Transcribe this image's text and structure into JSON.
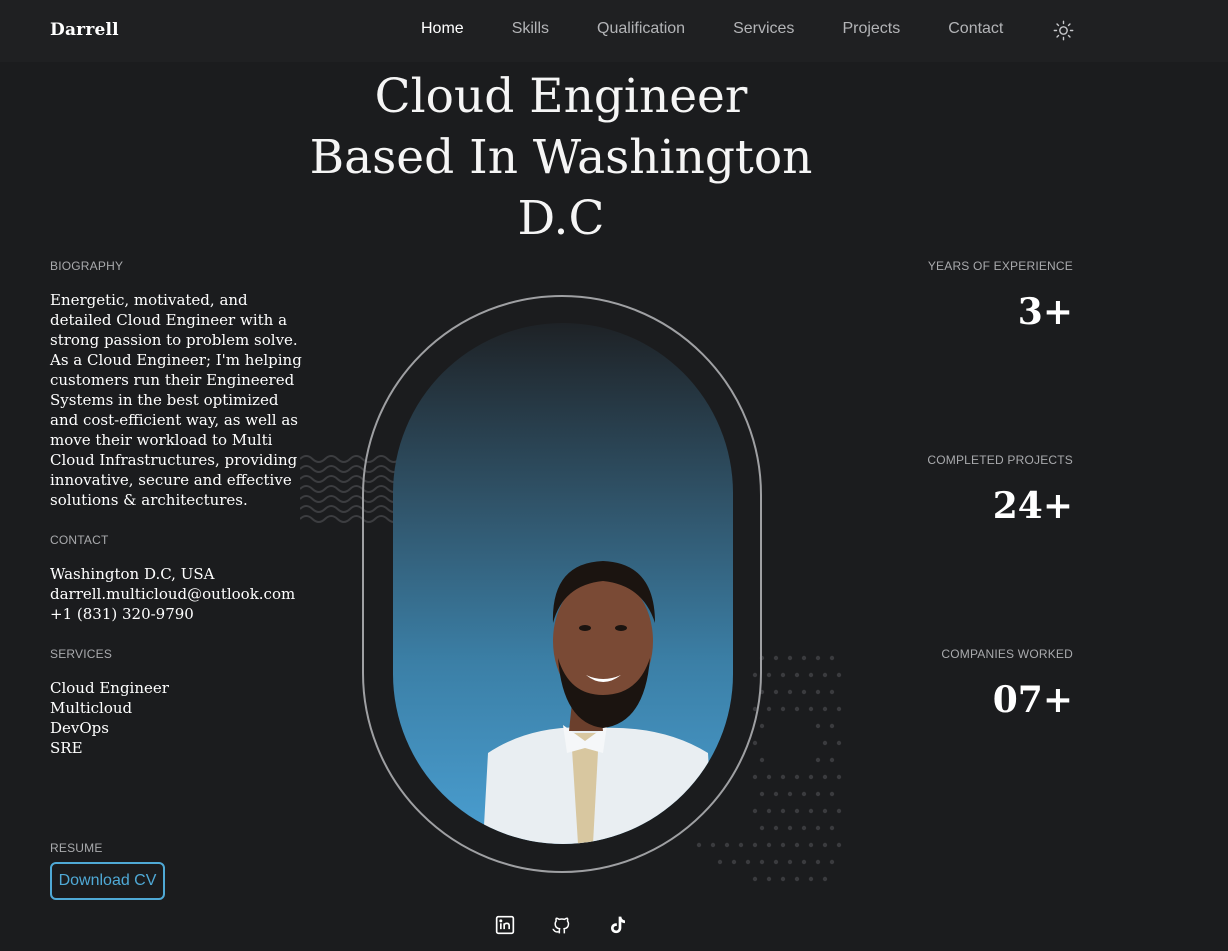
{
  "nav": {
    "logo": "Darrell",
    "items": [
      {
        "label": "Home",
        "active": true
      },
      {
        "label": "Skills"
      },
      {
        "label": "Qualification"
      },
      {
        "label": "Services"
      },
      {
        "label": "Projects"
      },
      {
        "label": "Contact"
      }
    ],
    "theme_icon": "sun-icon"
  },
  "hero": {
    "title_line1": "Cloud Engineer",
    "title_line2": "Based In Washington",
    "title_line3": "D.C"
  },
  "biography": {
    "label": "BIOGRAPHY",
    "lines": [
      "Energetic, motivated, and",
      "detailed Cloud Engineer with a",
      "strong passion to problem solve.",
      "As a Cloud Engineer; I'm helping",
      "customers run their Engineered",
      "Systems in the best optimized",
      "and cost-efficient way, as well as",
      "move their workload to Multi",
      "Cloud Infrastructures, providing",
      "innovative, secure and effective",
      "solutions & architectures."
    ]
  },
  "contact": {
    "label": "CONTACT",
    "location": "Washington D.C, USA",
    "email": "darrell.multicloud@outlook.com",
    "phone": "+1 (831) 320-9790"
  },
  "services": {
    "label": "SERVICES",
    "items": [
      "Cloud Engineer",
      "Multicloud",
      "DevOps",
      "SRE"
    ]
  },
  "resume": {
    "label": "RESUME",
    "button": "Download CV"
  },
  "stats": [
    {
      "label": "YEARS OF EXPERIENCE",
      "value": "3+"
    },
    {
      "label": "COMPLETED PROJECTS",
      "value": "24+"
    },
    {
      "label": "COMPANIES WORKED",
      "value": "07+"
    }
  ],
  "socials": [
    "linkedin-icon",
    "github-icon",
    "tiktok-icon"
  ],
  "colors": {
    "background": "#1b1c1e",
    "accent": "#4fa9d6",
    "muted": "#a9aaad"
  }
}
